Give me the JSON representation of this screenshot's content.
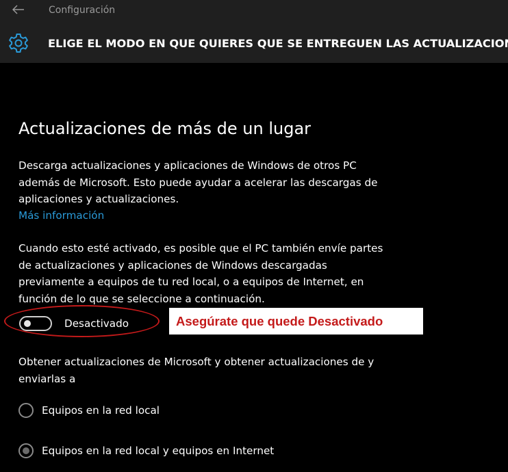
{
  "window": {
    "back_icon": "back-arrow-icon",
    "title": "Configuración"
  },
  "header": {
    "icon": "gear-icon",
    "heading": "ELIGE EL MODO EN QUE QUIERES QUE SE ENTREGUEN LAS ACTUALIZACIONES"
  },
  "section": {
    "title": "Actualizaciones de más de un lugar",
    "description": "Descarga actualizaciones y aplicaciones de Windows de otros PC además de Microsoft. Esto puede ayudar a acelerar las descargas de aplicaciones y actualizaciones.",
    "more_info_link": "Más información",
    "detail": "Cuando esto esté activado, es posible que el PC también envíe partes de actualizaciones y aplicaciones de Windows descargadas previamente a equipos de tu red local, o a equipos de Internet, en función de lo que se seleccione a continuación.",
    "toggle": {
      "state": "off",
      "label": "Desactivado"
    },
    "annotation": "Asegúrate que quede Desactivado",
    "options_prompt": "Obtener actualizaciones de Microsoft y obtener actualizaciones de y enviarlas a",
    "options": [
      {
        "label": "Equipos en la red local",
        "selected": false
      },
      {
        "label": "Equipos en la red local y equipos en Internet",
        "selected": true
      }
    ]
  },
  "colors": {
    "background": "#000000",
    "header_background": "#1f1f1f",
    "accent_link": "#2a9ad8",
    "gear": "#2a9ad8",
    "annotation_red": "#c41a1a"
  }
}
